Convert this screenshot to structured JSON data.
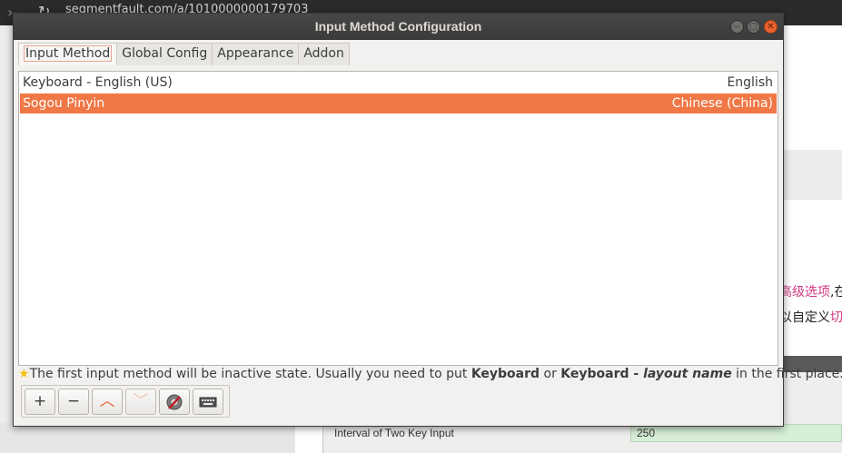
{
  "background": {
    "url_text": "segmentfault.com/a/1010000000179703",
    "text_line1_a": "高级选项",
    "text_line1_b": ",在",
    "text_line2_a": "以自定义",
    "text_line2_b": "切",
    "field_label": "Interval of Two Key Input",
    "field_value": "250"
  },
  "window": {
    "title": "Input Method Configuration",
    "close_symbol": "✕",
    "min_symbol": "–",
    "max_symbol": "□"
  },
  "tabs": [
    {
      "label": "Input Method",
      "active": true
    },
    {
      "label": "Global Config",
      "active": false
    },
    {
      "label": "Appearance",
      "active": false
    },
    {
      "label": "Addon",
      "active": false
    }
  ],
  "input_methods": [
    {
      "name": "Keyboard - English (US)",
      "language": "English",
      "selected": false
    },
    {
      "name": "Sogou Pinyin",
      "language": "Chinese (China)",
      "selected": true
    }
  ],
  "hint": {
    "prefix": "The first input method will be inactive state. Usually you need to put ",
    "bold1": "Keyboard",
    "mid": " or ",
    "bold2": "Keyboard - ",
    "bold_italic": "layout name",
    "suffix": " in the first place."
  },
  "toolbar": {
    "add_symbol": "+",
    "remove_symbol": "−",
    "up_symbol": "︿",
    "down_symbol": "﹀"
  },
  "colors": {
    "accent": "#f07746",
    "titlebar": "#3b3b3b",
    "window_bg": "#f2f1f0"
  }
}
